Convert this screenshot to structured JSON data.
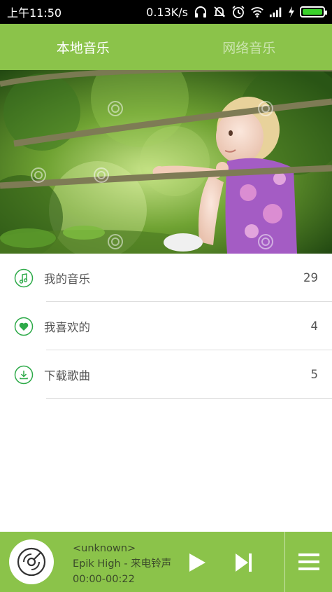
{
  "status_bar": {
    "time": "上午11:50",
    "speed": "0.13K/s",
    "icons": [
      "headphones-icon",
      "bell-off-icon",
      "alarm-icon",
      "wifi-icon",
      "signal-icon",
      "charging-icon",
      "battery-icon"
    ]
  },
  "tabs": [
    {
      "label": "本地音乐",
      "active": true
    },
    {
      "label": "网络音乐",
      "active": false
    }
  ],
  "banner": {
    "image": "child-on-rope-bridge-photo"
  },
  "list": [
    {
      "label": "我的音乐",
      "count": "29",
      "icon": "music-note-icon"
    },
    {
      "label": "我喜欢的",
      "count": "4",
      "icon": "heart-icon"
    },
    {
      "label": "下载歌曲",
      "count": "5",
      "icon": "download-icon"
    }
  ],
  "player": {
    "title": "<unknown>",
    "artist_song": "Epik High - 来电铃声",
    "time": "00:00-00:22",
    "icons": [
      "disc-icon",
      "play-icon",
      "next-icon",
      "menu-icon"
    ]
  },
  "colors": {
    "accent": "#8bc34a",
    "icon_green": "#2eaa49",
    "status_bg": "#000000"
  }
}
